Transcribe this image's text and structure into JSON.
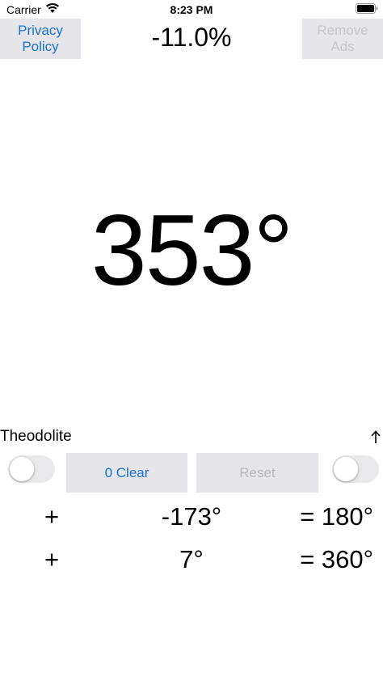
{
  "status_bar": {
    "carrier": "Carrier",
    "time": "8:23 PM"
  },
  "header": {
    "privacy_label": "Privacy\nPolicy",
    "percent": "-11.0%",
    "remove_ads_label": "Remove\nAds"
  },
  "main": {
    "heading": "353°"
  },
  "theodolite": {
    "label": "Theodolite",
    "clear_label": "0 Clear",
    "reset_label": "Reset",
    "left_switch_on": false,
    "right_switch_on": false
  },
  "rows": [
    {
      "op": "+",
      "value": "-173°",
      "result": "= 180°"
    },
    {
      "op": "+",
      "value": "7°",
      "result": "= 360°"
    }
  ],
  "colors": {
    "accent": "#1a73d4",
    "button_bg": "#e5e5ea",
    "disabled_text": "#c7c7cc"
  },
  "icons": {
    "wifi": "wifi-icon",
    "battery": "battery-icon",
    "arrow": "arrow-up-icon"
  }
}
